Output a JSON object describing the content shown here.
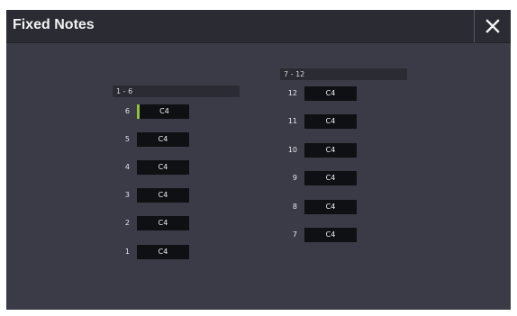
{
  "window": {
    "title": "Fixed Notes"
  },
  "groups": [
    {
      "header": "1 - 6",
      "rows": [
        {
          "num": "6",
          "value": "C4",
          "selected": true
        },
        {
          "num": "5",
          "value": "C4"
        },
        {
          "num": "4",
          "value": "C4"
        },
        {
          "num": "3",
          "value": "C4"
        },
        {
          "num": "2",
          "value": "C4"
        },
        {
          "num": "1",
          "value": "C4"
        }
      ]
    },
    {
      "header": "7 - 12",
      "rows": [
        {
          "num": "12",
          "value": "C4"
        },
        {
          "num": "11",
          "value": "C4"
        },
        {
          "num": "10",
          "value": "C4"
        },
        {
          "num": "9",
          "value": "C4"
        },
        {
          "num": "8",
          "value": "C4"
        },
        {
          "num": "7",
          "value": "C4"
        }
      ]
    }
  ],
  "colors": {
    "panel_bg": "#3a3b47",
    "title_bg": "#2a2b33",
    "field_bg": "#0f1013",
    "selection_accent": "#8fc43a"
  },
  "icons": {
    "close": "close-icon"
  }
}
